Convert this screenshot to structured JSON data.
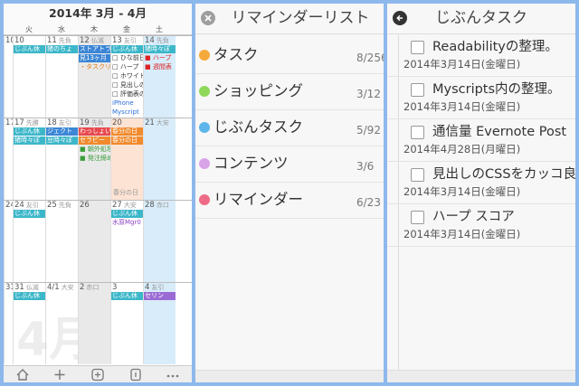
{
  "calendar": {
    "title": "2014年 3月 - 4月",
    "weekdays": [
      "火",
      "水",
      "木",
      "金",
      "土"
    ],
    "watermark": "4月",
    "weeks": [
      {
        "days": [
          {
            "num": "10",
            "rk": "",
            "cls": "",
            "events": [
              {
                "c": "teal",
                "t": "じぶん休"
              }
            ]
          },
          {
            "num": "11",
            "rk": "先負",
            "cls": "",
            "events": [
              {
                "c": "teal",
                "t": "猪のちょ"
              }
            ]
          },
          {
            "num": "12",
            "rk": "仏滅",
            "cls": "grey",
            "events": [
              {
                "c": "blue",
                "t": "ストアトラ"
              },
              {
                "c": "blue",
                "t": "見13ヶ月"
              },
              {
                "c": "txt o",
                "t": "・タスクリ"
              }
            ]
          },
          {
            "num": "13",
            "rk": "友引",
            "cls": "",
            "events": [
              {
                "c": "teal",
                "t": "じぶん休"
              },
              {
                "c": "txt",
                "t": "□ ひな前日"
              },
              {
                "c": "txt",
                "t": "□ ハープ"
              },
              {
                "c": "txt",
                "t": "□ ホワイト"
              },
              {
                "c": "txt",
                "t": "□ 見出しの"
              },
              {
                "c": "txt",
                "t": "□ 評価表の"
              },
              {
                "c": "txt b",
                "t": "iPhone"
              },
              {
                "c": "txt b",
                "t": "Myscript"
              },
              {
                "c": "txt b",
                "t": "Readabi"
              }
            ]
          },
          {
            "num": "14",
            "rk": "先負",
            "cls": "blue",
            "events": [
              {
                "c": "teal",
                "t": "猪時々ぽ"
              },
              {
                "c": "txt r",
                "t": "■ ハープ"
              },
              {
                "c": "txt r",
                "t": "■ 週間表"
              }
            ]
          }
        ]
      },
      {
        "days": [
          {
            "num": "17",
            "rk": "先勝",
            "cls": "",
            "events": [
              {
                "c": "teal",
                "t": "じぶん休"
              },
              {
                "c": "teal",
                "t": "猪時々ぽ"
              }
            ]
          },
          {
            "num": "18",
            "rk": "友引",
            "cls": "",
            "events": [
              {
                "c": "blue",
                "t": "ジェクト"
              },
              {
                "c": "teal",
                "t": "豆時々ぽ"
              }
            ]
          },
          {
            "num": "19",
            "rk": "先負",
            "cls": "grey",
            "events": [
              {
                "c": "red",
                "t": "わっしょい"
              },
              {
                "c": "orange",
                "t": "セラピー"
              },
              {
                "c": "txt g",
                "t": "■ 朝外処理"
              },
              {
                "c": "txt g",
                "t": "■ 発注締め"
              }
            ]
          },
          {
            "num": "20",
            "rk": "",
            "cls": "today",
            "events": [
              {
                "c": "orange",
                "t": "春分の日"
              },
              {
                "c": "orange",
                "t": "春分の日"
              }
            ]
          },
          {
            "num": "21",
            "rk": "大安",
            "cls": "blue",
            "events": []
          }
        ]
      },
      {
        "days": [
          {
            "num": "24",
            "rk": "友引",
            "cls": "",
            "events": [
              {
                "c": "teal",
                "t": "じぶん休"
              }
            ]
          },
          {
            "num": "25",
            "rk": "先負",
            "cls": "",
            "events": []
          },
          {
            "num": "26",
            "rk": "",
            "cls": "grey",
            "events": []
          },
          {
            "num": "27",
            "rk": "大安",
            "cls": "",
            "events": [
              {
                "c": "teal",
                "t": "じぶん休"
              },
              {
                "c": "txt p",
                "t": "水原Mgr0"
              }
            ]
          },
          {
            "num": "28",
            "rk": "赤口",
            "cls": "blue",
            "events": []
          }
        ]
      },
      {
        "days": [
          {
            "num": "31",
            "rk": "仏滅",
            "cls": "",
            "events": [
              {
                "c": "teal",
                "t": "じぶん休"
              }
            ]
          },
          {
            "num": "4/1",
            "rk": "大安",
            "cls": "",
            "events": []
          },
          {
            "num": "2",
            "rk": "赤口",
            "cls": "grey",
            "events": []
          },
          {
            "num": "3",
            "rk": "",
            "cls": "",
            "events": [
              {
                "c": "teal",
                "t": "じぶん休"
              }
            ]
          },
          {
            "num": "4",
            "rk": "友引",
            "cls": "blue",
            "events": [
              {
                "c": "purple",
                "t": "セリン"
              }
            ]
          }
        ]
      }
    ],
    "side_nums": [
      "10",
      "17",
      "24",
      "31"
    ],
    "spring_label": "春分の日"
  },
  "reminder_list": {
    "title": "リマインダーリスト",
    "items": [
      {
        "name": "タスク",
        "count": "8/256",
        "color": "#f5a93a"
      },
      {
        "name": "ショッピング",
        "count": "3/12",
        "color": "#8fd85a"
      },
      {
        "name": "じぶんタスク",
        "count": "5/92",
        "color": "#5db6ea"
      },
      {
        "name": "コンテンツ",
        "count": "3/6",
        "color": "#d9a3e8"
      },
      {
        "name": "リマインダー",
        "count": "6/23",
        "color": "#ee6b87"
      }
    ]
  },
  "task_list": {
    "title": "じぶんタスク",
    "items": [
      {
        "title": "Readabilityの整理。",
        "date": "2014年3月14日(金曜日)"
      },
      {
        "title": "Myscripts内の整理。",
        "date": "2014年3月14日(金曜日)"
      },
      {
        "title": "通信量 Evernote Post",
        "date": "2014年4月28日(月曜日)"
      },
      {
        "title": "見出しのCSSをカッコ良",
        "date": "2014年3月14日(金曜日)"
      },
      {
        "title": "ハープ スコア",
        "date": "2014年3月14日(金曜日)"
      }
    ]
  }
}
